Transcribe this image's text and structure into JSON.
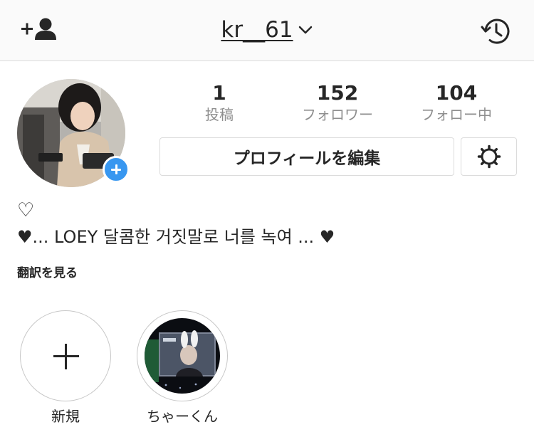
{
  "header": {
    "username": "kr__61",
    "add_user_icon": "add-user-icon",
    "history_icon": "history-icon",
    "dropdown_icon": "chevron-down-icon"
  },
  "profile": {
    "stats": [
      {
        "value": "1",
        "label": "投稿"
      },
      {
        "value": "152",
        "label": "フォロワー"
      },
      {
        "value": "104",
        "label": "フォロー中"
      }
    ],
    "edit_profile_label": "プロフィールを編集",
    "settings_icon": "gear-icon",
    "bio_line1": "♡",
    "bio_line2": "♥︎... LOEY 달콤한 거짓말로 너를 녹여 ... ♥︎",
    "translate_label": "翻訳を見る"
  },
  "highlights": [
    {
      "label": "新規",
      "icon": "plus-icon"
    },
    {
      "label": "ちゃーくん"
    }
  ],
  "colors": {
    "accent_blue": "#3897f0",
    "text_primary": "#262626",
    "text_secondary": "#8e8e8e",
    "border": "#dbdbdb",
    "header_bg": "#fafafa"
  }
}
